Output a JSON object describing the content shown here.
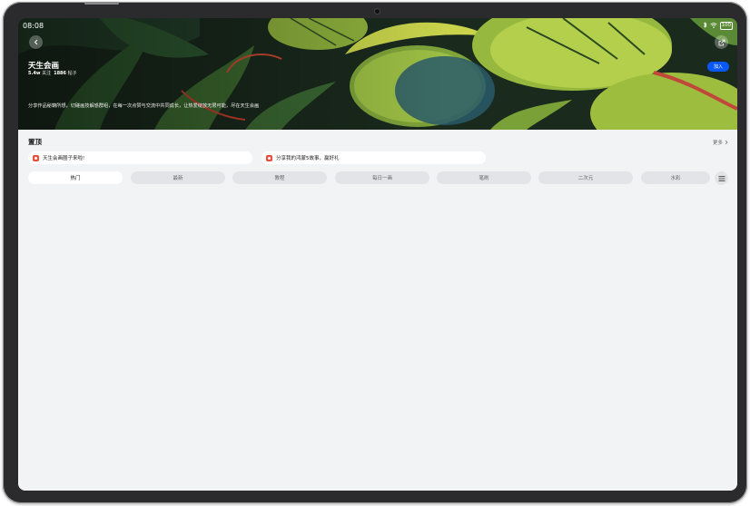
{
  "status_bar": {
    "time": "08:08",
    "battery": "100"
  },
  "community": {
    "title": "天生会画",
    "members_count": "5.4w",
    "members_label": "关注",
    "posts_count": "1886",
    "posts_label": "帖子",
    "description": "分享作品秘籍所想，切磋画技解惑群组，在每一次点赞与交流中共同成长，让热爱绽放无限可能，尽在天生会画",
    "join_label": "加入"
  },
  "pinned": {
    "title": "置顶",
    "more_label": "更多",
    "items": [
      {
        "text": "天生会画圈子来啦!"
      },
      {
        "text": "分享我的鸿蒙5故事，赢好礼"
      }
    ]
  },
  "tabs": [
    {
      "label": "热门"
    },
    {
      "label": "最新"
    },
    {
      "label": "教程"
    },
    {
      "label": "每日一画"
    },
    {
      "label": "笔刷"
    },
    {
      "label": "二次元"
    },
    {
      "label": "水彩"
    }
  ],
  "colors": {
    "accent": "#0a59f7",
    "pin_tag": "#e84f3d",
    "background": "#f2f3f5"
  }
}
